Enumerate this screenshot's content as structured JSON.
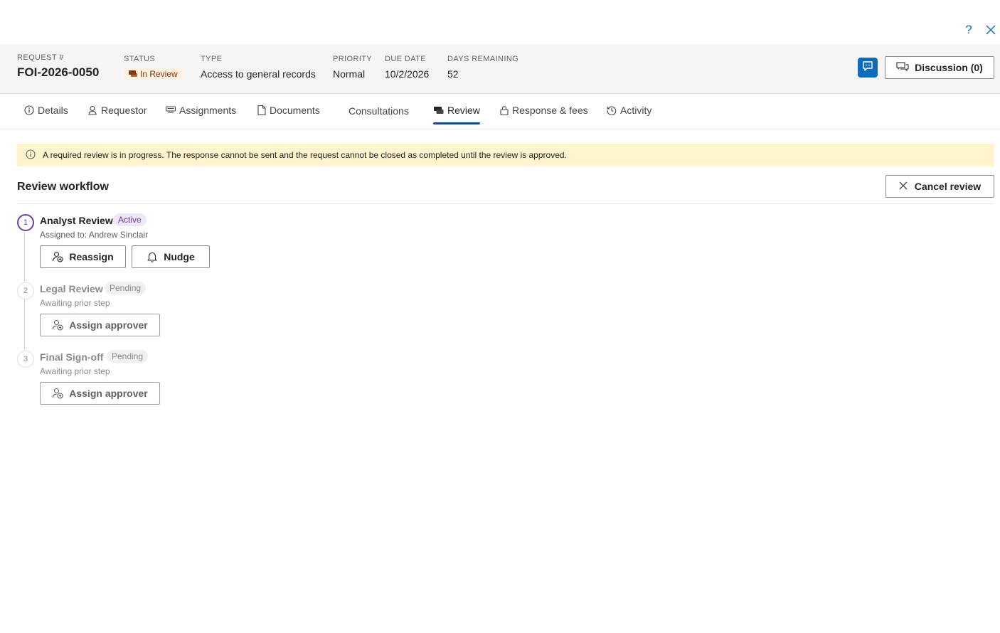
{
  "window": {
    "help_icon": "question-mark-icon",
    "close_icon": "close-icon"
  },
  "header": {
    "request": {
      "label": "REQUEST #",
      "value": "FOI-2026-0050"
    },
    "status": {
      "label": "STATUS",
      "value": "In Review",
      "color": "#8a3707",
      "background": "#fdf1e4"
    },
    "type": {
      "label": "TYPE",
      "value": "Access to general records"
    },
    "priority": {
      "label": "PRIORITY",
      "value": "Normal"
    },
    "due_date": {
      "label": "DUE DATE",
      "value": "10/2/2026"
    },
    "days_remaining": {
      "label": "DAYS REMAINING",
      "value": "52"
    },
    "discussion_label": "Discussion (0)"
  },
  "tabs": [
    {
      "label": "Details",
      "icon": "info-icon"
    },
    {
      "label": "Requestor",
      "icon": "person-icon"
    },
    {
      "label": "Assignments",
      "icon": "assignments-icon"
    },
    {
      "label": "Documents",
      "icon": "document-icon"
    },
    {
      "label": "Consultations",
      "icon": ""
    },
    {
      "label": "Review",
      "icon": "review-icon",
      "active": true
    },
    {
      "label": "Response & fees",
      "icon": "lock-icon"
    },
    {
      "label": "Activity",
      "icon": "history-icon"
    }
  ],
  "banner": {
    "text": "A required review is in progress. The response cannot be sent and the request cannot be closed as completed until the review is approved."
  },
  "review": {
    "title": "Review workflow",
    "cancel_label": "Cancel review",
    "steps": [
      {
        "number": "1",
        "name": "Analyst Review",
        "badge": "Active",
        "subtitle": "Assigned to: Andrew Sinclair",
        "actions": [
          "Reassign",
          "Nudge"
        ]
      },
      {
        "number": "2",
        "name": "Legal Review",
        "badge": "Pending",
        "subtitle": "Awaiting prior step",
        "actions": [
          "Assign approver"
        ]
      },
      {
        "number": "3",
        "name": "Final Sign-off",
        "badge": "Pending",
        "subtitle": "Awaiting prior step",
        "actions": [
          "Assign approver"
        ]
      }
    ]
  },
  "colors": {
    "accent": "#0f6cbd",
    "active_step": "#6b3f9e",
    "banner_bg": "#fff4ce"
  }
}
